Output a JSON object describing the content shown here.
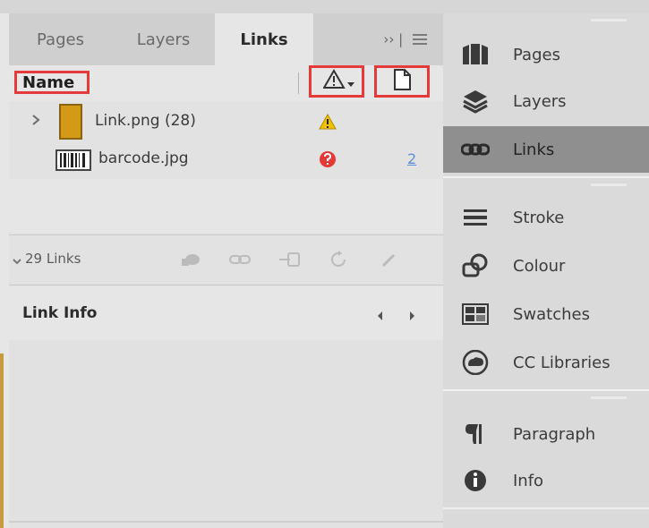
{
  "tabs": [
    "Pages",
    "Layers",
    "Links"
  ],
  "tab_overflow": "›› |",
  "list_header": {
    "name_label": "Name"
  },
  "links": [
    {
      "name": "Link.png (28)",
      "status_icon": "warning-icon"
    },
    {
      "name": "barcode.jpg",
      "status_icon": "missing-link-icon",
      "page": "2"
    }
  ],
  "links_count": "29 Links",
  "link_info": {
    "label": "Link Info"
  },
  "right_panel": {
    "items": [
      {
        "label": "Pages",
        "icon": "pages-icon"
      },
      {
        "label": "Layers",
        "icon": "layers-icon"
      },
      {
        "label": "Links",
        "icon": "links-icon",
        "active": true
      },
      {
        "label": "Stroke",
        "icon": "stroke-icon"
      },
      {
        "label": "Colour",
        "icon": "colour-icon"
      },
      {
        "label": "Swatches",
        "icon": "swatches-icon"
      },
      {
        "label": "CC Libraries",
        "icon": "cc-libraries-icon"
      },
      {
        "label": "Paragraph",
        "icon": "paragraph-icon"
      },
      {
        "label": "Info",
        "icon": "info-icon"
      }
    ]
  },
  "colors": {
    "highlight_red": "#e43a3a",
    "warning_yellow": "#f2c200",
    "missing_red": "#e53935",
    "page_blue": "#5a8fd8",
    "link_folder": "#d39a17"
  }
}
